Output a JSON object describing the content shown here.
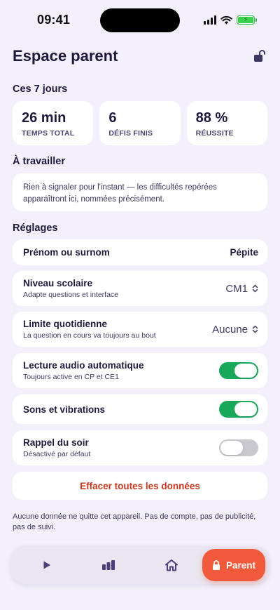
{
  "status_bar": {
    "time": "09:41"
  },
  "header": {
    "title": "Espace parent",
    "lock_icon": "unlock-icon"
  },
  "stats_section": {
    "label": "Ces 7 jours",
    "cards": [
      {
        "value": "26 min",
        "label": "TEMPS TOTAL"
      },
      {
        "value": "6",
        "label": "DÉFIS FINIS"
      },
      {
        "value": "88 %",
        "label": "RÉUSSITE"
      }
    ]
  },
  "work_section": {
    "label": "À travailler",
    "message": "Rien à signaler pour l'instant — les difficultés repérées apparaîtront ici, nommées précisément."
  },
  "settings": {
    "label": "Réglages",
    "nickname": {
      "title": "Prénom ou surnom",
      "value": "Pépite"
    },
    "level": {
      "title": "Niveau scolaire",
      "subtitle": "Adapte questions et interface",
      "value": "CM1"
    },
    "daily_limit": {
      "title": "Limite quotidienne",
      "subtitle": "La question en cours va toujours au bout",
      "value": "Aucune"
    },
    "audio": {
      "title": "Lecture audio automatique",
      "subtitle": "Toujours active en CP et CE1",
      "enabled": true
    },
    "sounds": {
      "title": "Sons et vibrations",
      "enabled": true
    },
    "reminder": {
      "title": "Rappel du soir",
      "subtitle": "Désactivé par défaut",
      "enabled": false
    }
  },
  "actions": {
    "erase_label": "Effacer toutes les données"
  },
  "footer_note": "Aucune donnée ne quitte cet appareil. Pas de compte, pas de publicité, pas de suivi.",
  "tab_bar": {
    "tabs": [
      {
        "icon": "play-icon"
      },
      {
        "icon": "bar-chart-icon"
      },
      {
        "icon": "home-icon"
      }
    ],
    "active": {
      "icon": "lock-icon",
      "label": "Parent"
    }
  },
  "colors": {
    "background": "#f3f0fb",
    "text": "#1f1a3d",
    "toggle_on": "#19a85a",
    "danger": "#c9361e",
    "accent": "#f05a3a"
  }
}
